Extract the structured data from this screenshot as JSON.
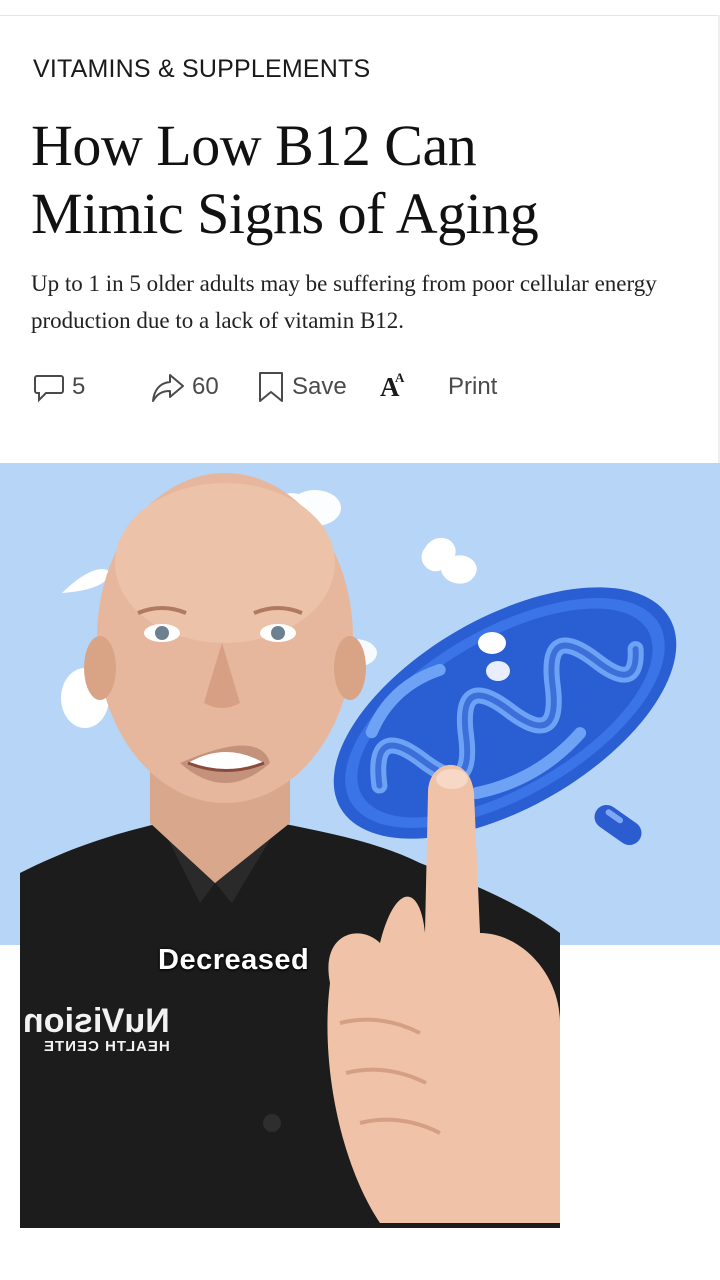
{
  "article": {
    "category": "VITAMINS & SUPPLEMENTS",
    "headline_line1": "How Low B12 Can",
    "headline_line2": "Mimic Signs of Aging",
    "dek": "Up to 1 in 5 older adults may be suffering from poor cellular energy production due to a lack of vitamin B12."
  },
  "actions": {
    "comments_count": "5",
    "shares_count": "60",
    "save_label": "Save",
    "font_size_glyph": "A",
    "font_size_glyph_small": "A",
    "print_label": "Print"
  },
  "video": {
    "caption": "Decreased",
    "shirt_logo_main": "NuVision",
    "shirt_logo_sub": "HEALTH CENTE"
  },
  "icons": {
    "comments": "speech-bubble-icon",
    "share": "share-arrow-icon",
    "save": "bookmark-icon",
    "text_size": "font-size-icon"
  },
  "colors": {
    "hero_background": "#b7d5f6",
    "mitochondrion": "#2f67d9",
    "shirt": "#1b1b1b",
    "text_primary": "#111111",
    "text_secondary": "#4a4a4a"
  }
}
